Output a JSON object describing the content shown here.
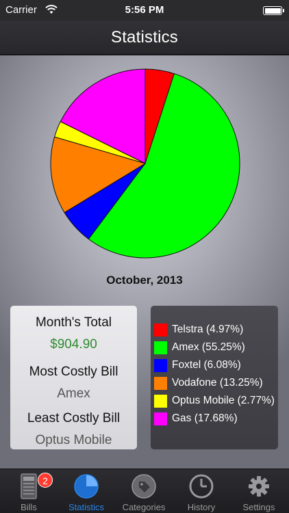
{
  "status_bar": {
    "carrier": "Carrier",
    "time": "5:56 PM"
  },
  "nav": {
    "title": "Statistics"
  },
  "chart_data": {
    "type": "pie",
    "title": "October, 2013",
    "slices": [
      {
        "label": "Telstra",
        "percent": 4.97,
        "color": "#ff0000"
      },
      {
        "label": "Amex",
        "percent": 55.25,
        "color": "#00ff00"
      },
      {
        "label": "Foxtel",
        "percent": 6.08,
        "color": "#0000ff"
      },
      {
        "label": "Vodafone",
        "percent": 13.25,
        "color": "#ff8000"
      },
      {
        "label": "Optus Mobile",
        "percent": 2.77,
        "color": "#ffff00"
      },
      {
        "label": "Gas",
        "percent": 17.68,
        "color": "#ff00ff"
      }
    ],
    "legend_placement": "bottom-right"
  },
  "summary": {
    "month_total_label": "Month's Total",
    "month_total_value": "$904.90",
    "most_costly_label": "Most Costly Bill",
    "most_costly_value": "Amex",
    "least_costly_label": "Least Costly Bill",
    "least_costly_value": "Optus Mobile"
  },
  "legend": [
    {
      "text": "Telstra (4.97%)",
      "color": "#ff0000"
    },
    {
      "text": "Amex (55.25%)",
      "color": "#00ff00"
    },
    {
      "text": "Foxtel (6.08%)",
      "color": "#0000ff"
    },
    {
      "text": "Vodafone (13.25%)",
      "color": "#ff8000"
    },
    {
      "text": "Optus Mobile (2.77%)",
      "color": "#ffff00"
    },
    {
      "text": "Gas (17.68%)",
      "color": "#ff00ff"
    }
  ],
  "tabs": [
    {
      "label": "Bills",
      "icon": "bill-icon",
      "badge": "2",
      "active": false
    },
    {
      "label": "Statistics",
      "icon": "pie-chart-icon",
      "active": true
    },
    {
      "label": "Categories",
      "icon": "tag-icon",
      "active": false
    },
    {
      "label": "History",
      "icon": "clock-icon",
      "active": false
    },
    {
      "label": "Settings",
      "icon": "gear-icon",
      "active": false
    }
  ]
}
